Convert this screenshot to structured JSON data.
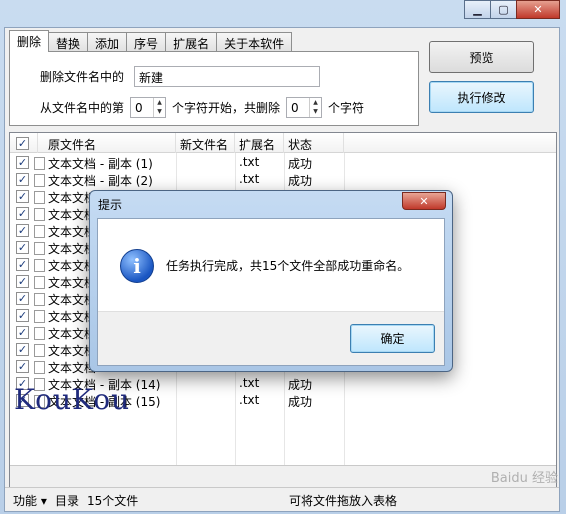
{
  "window": {
    "buttons": {
      "minimize": "▁",
      "maximize": "▢",
      "close": "✕"
    }
  },
  "tabs": [
    "删除",
    "替换",
    "添加",
    "序号",
    "扩展名",
    "关于本软件"
  ],
  "delete_panel": {
    "label1": "删除文件名中的",
    "value1": "新建",
    "label2": "从文件名中的第",
    "spin1": "0",
    "label3": "个字符开始，共删除",
    "spin2": "0",
    "label4": "个字符"
  },
  "buttons": {
    "preview": "预览",
    "execute": "执行修改"
  },
  "list": {
    "columns": [
      "原文件名",
      "新文件名",
      "扩展名",
      "状态"
    ],
    "rows": [
      {
        "name": "文本文档 - 副本 (1)",
        "ext": ".txt",
        "status": "成功"
      },
      {
        "name": "文本文档 - 副本 (2)",
        "ext": ".txt",
        "status": "成功"
      },
      {
        "name": "文本文档",
        "ext": "",
        "status": ""
      },
      {
        "name": "文本文档",
        "ext": "",
        "status": ""
      },
      {
        "name": "文本文档",
        "ext": "",
        "status": ""
      },
      {
        "name": "文本文档",
        "ext": "",
        "status": ""
      },
      {
        "name": "文本文档",
        "ext": "",
        "status": ""
      },
      {
        "name": "文本文档",
        "ext": "",
        "status": ""
      },
      {
        "name": "文本文档",
        "ext": "",
        "status": ""
      },
      {
        "name": "文本文档",
        "ext": "",
        "status": ""
      },
      {
        "name": "文本文档",
        "ext": "",
        "status": ""
      },
      {
        "name": "文本文档",
        "ext": "",
        "status": ""
      },
      {
        "name": "文本文档",
        "ext": "",
        "status": ""
      },
      {
        "name": "文本文档 - 副本 (14)",
        "ext": ".txt",
        "status": "成功"
      },
      {
        "name": "文本文档 - 副本 (15)",
        "ext": ".txt",
        "status": "成功"
      }
    ]
  },
  "statusbar": {
    "func": "功能 ▾",
    "dir": "目录",
    "count": "15个文件",
    "hint": "可将文件拖放入表格"
  },
  "watermark": "KouKou",
  "badge": "Baidu 经验",
  "dialog": {
    "title": "提示",
    "close": "✕",
    "icon": "i",
    "message": "任务执行完成，共15个文件全部成功重命名。",
    "ok": "确定"
  }
}
